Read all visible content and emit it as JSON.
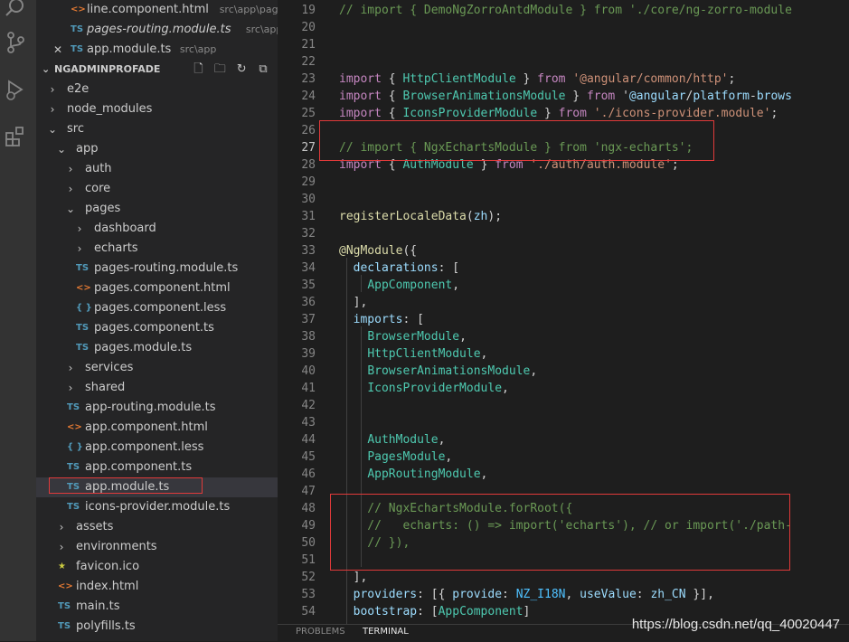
{
  "open_editors": [
    {
      "name": "line.component.html",
      "path": "src\\app\\pages...",
      "icon": "html-file-icon",
      "italic": false
    },
    {
      "name": "pages-routing.module.ts",
      "path": "src\\app\\pa...",
      "icon": "ts-file-icon",
      "italic": true
    },
    {
      "name": "app.module.ts",
      "path": "src\\app",
      "icon": "ts-file-icon",
      "italic": false
    }
  ],
  "explorer": {
    "project": "NGADMINPROFADE",
    "items": [
      {
        "label": "e2e",
        "type": "folder"
      },
      {
        "label": "node_modules",
        "type": "folder"
      },
      {
        "label": "src",
        "type": "folder-open"
      },
      {
        "label": "app",
        "type": "folder-open"
      },
      {
        "label": "auth",
        "type": "folder"
      },
      {
        "label": "core",
        "type": "folder"
      },
      {
        "label": "pages",
        "type": "folder-open"
      },
      {
        "label": "dashboard",
        "type": "folder"
      },
      {
        "label": "echarts",
        "type": "folder"
      },
      {
        "label": "pages-routing.module.ts",
        "type": "ts"
      },
      {
        "label": "pages.component.html",
        "type": "html"
      },
      {
        "label": "pages.component.less",
        "type": "less"
      },
      {
        "label": "pages.component.ts",
        "type": "ts"
      },
      {
        "label": "pages.module.ts",
        "type": "ts"
      },
      {
        "label": "services",
        "type": "folder"
      },
      {
        "label": "shared",
        "type": "folder"
      },
      {
        "label": "app-routing.module.ts",
        "type": "ts"
      },
      {
        "label": "app.component.html",
        "type": "html"
      },
      {
        "label": "app.component.less",
        "type": "less"
      },
      {
        "label": "app.component.ts",
        "type": "ts"
      },
      {
        "label": "app.module.ts",
        "type": "ts"
      },
      {
        "label": "icons-provider.module.ts",
        "type": "ts"
      },
      {
        "label": "assets",
        "type": "folder"
      },
      {
        "label": "environments",
        "type": "folder"
      },
      {
        "label": "favicon.ico",
        "type": "star"
      },
      {
        "label": "index.html",
        "type": "html"
      },
      {
        "label": "main.ts",
        "type": "ts"
      },
      {
        "label": "polyfills.ts",
        "type": "ts"
      }
    ]
  },
  "code_lines": [
    {
      "n": "19",
      "text": "// import { DemoNgZorroAntdModule } from './core/ng-zorro-module"
    },
    {
      "n": "20",
      "text": ""
    },
    {
      "n": "21",
      "text": ""
    },
    {
      "n": "22",
      "text": ""
    },
    {
      "n": "23",
      "text": "import { HttpClientModule } from '@angular/common/http';"
    },
    {
      "n": "24",
      "text": "import { BrowserAnimationsModule } from '@angular/platform-brows"
    },
    {
      "n": "25",
      "text": "import { IconsProviderModule } from './icons-provider.module';"
    },
    {
      "n": "26",
      "text": ""
    },
    {
      "n": "27",
      "text": "// import { NgxEchartsModule } from 'ngx-echarts';"
    },
    {
      "n": "28",
      "text": "import { AuthModule } from './auth/auth.module';"
    },
    {
      "n": "29",
      "text": ""
    },
    {
      "n": "30",
      "text": ""
    },
    {
      "n": "31",
      "text": "registerLocaleData(zh);"
    },
    {
      "n": "32",
      "text": ""
    },
    {
      "n": "33",
      "text": "@NgModule({"
    },
    {
      "n": "34",
      "text": "  declarations: ["
    },
    {
      "n": "35",
      "text": "    AppComponent,"
    },
    {
      "n": "36",
      "text": "  ],"
    },
    {
      "n": "37",
      "text": "  imports: ["
    },
    {
      "n": "38",
      "text": "    BrowserModule,"
    },
    {
      "n": "39",
      "text": "    HttpClientModule,"
    },
    {
      "n": "40",
      "text": "    BrowserAnimationsModule,"
    },
    {
      "n": "41",
      "text": "    IconsProviderModule,"
    },
    {
      "n": "42",
      "text": ""
    },
    {
      "n": "43",
      "text": ""
    },
    {
      "n": "44",
      "text": "    AuthModule,"
    },
    {
      "n": "45",
      "text": "    PagesModule,"
    },
    {
      "n": "46",
      "text": "    AppRoutingModule,"
    },
    {
      "n": "47",
      "text": ""
    },
    {
      "n": "48",
      "text": "    // NgxEchartsModule.forRoot({"
    },
    {
      "n": "49",
      "text": "    //   echarts: () => import('echarts'), // or import('./path-"
    },
    {
      "n": "50",
      "text": "    // }),"
    },
    {
      "n": "51",
      "text": ""
    },
    {
      "n": "52",
      "text": "  ],"
    },
    {
      "n": "53",
      "text": "  providers: [{ provide: NZ_I18N, useValue: zh_CN }],"
    },
    {
      "n": "54",
      "text": "  bootstrap: [AppComponent]"
    }
  ],
  "panel_tabs": [
    "PROBLEMS",
    "TERMINAL"
  ],
  "watermark": "https://blog.csdn.net/qq_40020447",
  "colors": {
    "highlight_box": "#e03a3a",
    "sidebar_bg": "#252526",
    "editor_bg": "#1e1e1e"
  }
}
